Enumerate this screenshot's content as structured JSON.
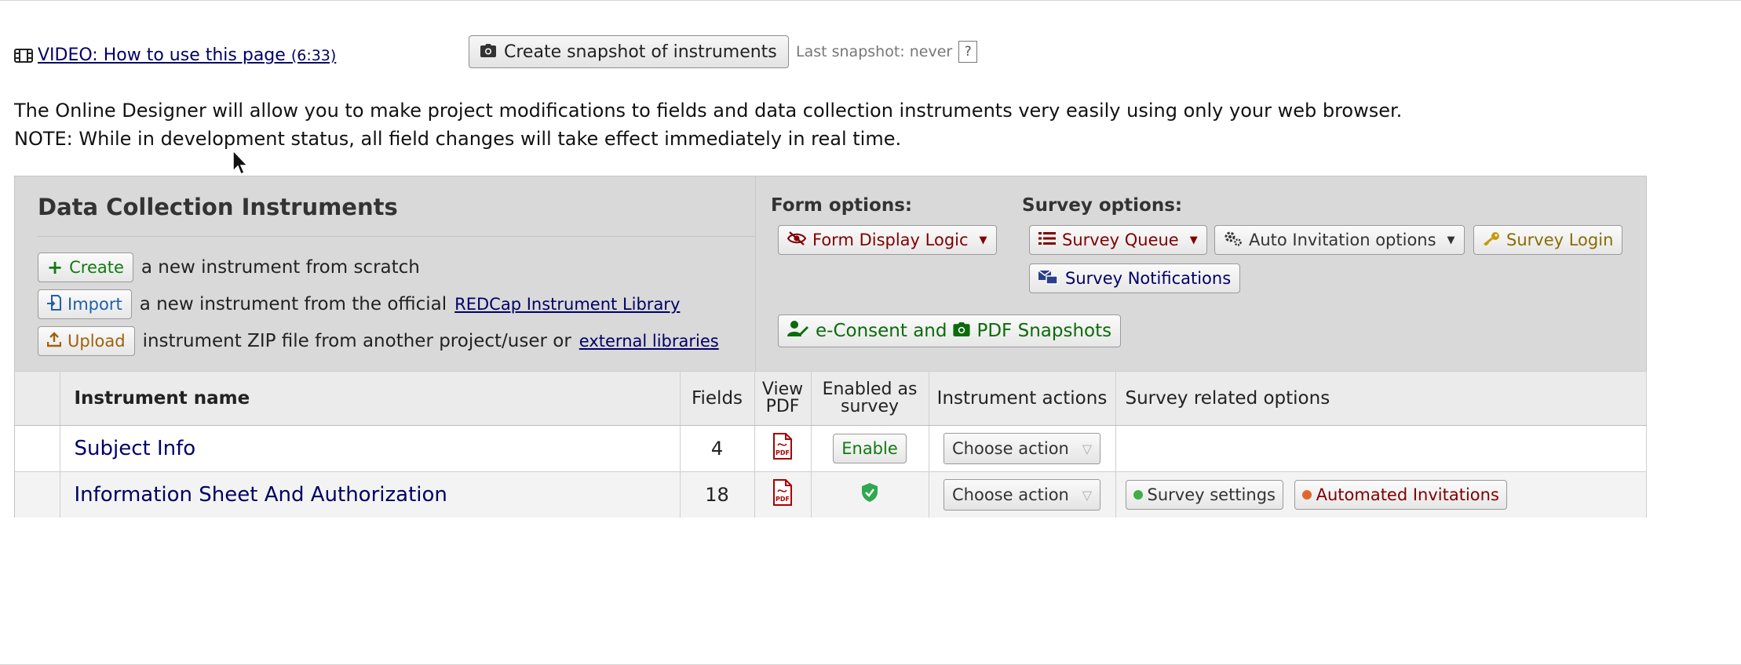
{
  "header": {
    "video_link": "VIDEO: How to use this page",
    "video_duration": "(6:33)",
    "snapshot_button": "Create snapshot of instruments",
    "last_snapshot": "Last snapshot: never",
    "help": "?"
  },
  "intro": {
    "line1": "The Online Designer will allow you to make project modifications to fields and data collection instruments very easily using only your web browser.",
    "line2": "NOTE: While in development status, all field changes will take effect immediately in real time."
  },
  "panel": {
    "title": "Data Collection Instruments",
    "create_button": "Create",
    "create_text": "a new instrument from scratch",
    "import_button": "Import",
    "import_text": "a new instrument from the official",
    "import_link": "REDCap Instrument Library",
    "upload_button": "Upload",
    "upload_text": "instrument ZIP file from another project/user or",
    "upload_link": "external libraries",
    "form_options_label": "Form options:",
    "form_display_logic": "Form Display Logic",
    "survey_options_label": "Survey options:",
    "survey_queue": "Survey Queue",
    "auto_invitation": "Auto Invitation options",
    "survey_login": "Survey Login",
    "survey_notifications": "Survey Notifications",
    "econsent_part1": "e-Consent and",
    "econsent_part2": "PDF Snapshots"
  },
  "table": {
    "headers": {
      "name": "Instrument name",
      "fields": "Fields",
      "view_pdf_1": "View",
      "view_pdf_2": "PDF",
      "enabled_1": "Enabled as",
      "enabled_2": "survey",
      "actions": "Instrument actions",
      "survey_options": "Survey related options"
    },
    "rows": [
      {
        "name": "Subject Info",
        "fields": "4",
        "enabled": "Enable",
        "action": "Choose action"
      },
      {
        "name": "Information Sheet And Authorization",
        "fields": "18",
        "action": "Choose action",
        "survey_settings": "Survey settings",
        "automated_invitations": "Automated Invitations"
      }
    ]
  },
  "colors": {
    "navy_link": "#000066",
    "maroon": "#800000",
    "green": "#117a11",
    "panel_bg": "#d9d9d9"
  }
}
